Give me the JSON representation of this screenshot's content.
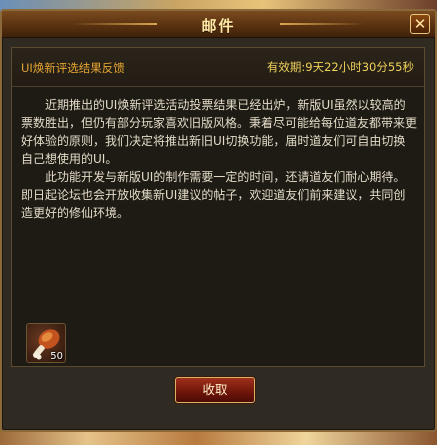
{
  "window": {
    "title": "邮件",
    "close_symbol": "✕"
  },
  "mail": {
    "subject": "UI焕新评选结果反馈",
    "validity": "有效期:9天22小时30分55秒",
    "paragraphs": [
      "近期推出的UI焕新评选活动投票结果已经出炉，新版UI虽然以较高的票数胜出，但仍有部分玩家喜欢旧版风格。秉着尽可能给每位道友都带来更好体验的原则，我们决定将推出新旧UI切换功能，届时道友们可自由切换自己想使用的UI。",
      "此功能开发与新版UI的制作需要一定的时间，还请道友们耐心期待。即日起论坛也会开放收集新UI建议的帖子，欢迎道友们前来建议，共同创造更好的修仙环境。"
    ]
  },
  "attachment": {
    "icon": "roast-drumstick-icon",
    "count": "50"
  },
  "actions": {
    "collect_label": "收取"
  },
  "colors": {
    "subject": "#e4a531",
    "validity": "#f1d25a",
    "body_text": "#e3dcc8",
    "title": "#ffe9a6"
  }
}
